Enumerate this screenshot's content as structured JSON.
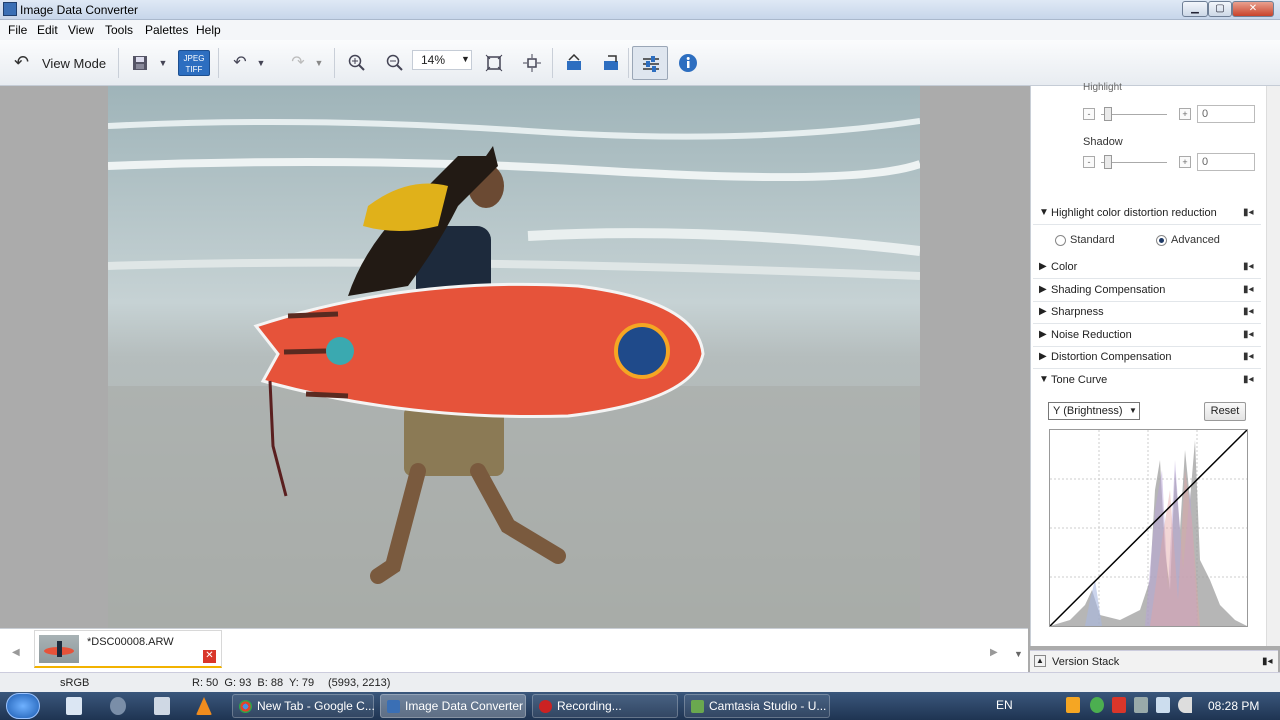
{
  "window": {
    "title": "Image Data Converter",
    "min_label": "▁",
    "max_label": "▢",
    "close_label": "✕"
  },
  "menu": [
    "File",
    "Edit",
    "View",
    "Tools",
    "Palettes",
    "Help"
  ],
  "toolbar": {
    "view_mode_label": "View Mode",
    "zoom_value": "14%",
    "jpeg_tiff_label": "JPEG TIFF"
  },
  "panel": {
    "highlight_label": "Highlight",
    "highlight_value": "0",
    "shadow_label": "Shadow",
    "shadow_value": "0",
    "sections": {
      "highlight_color": "Highlight color distortion reduction",
      "color": "Color",
      "shading": "Shading Compensation",
      "sharpness": "Sharpness",
      "noise": "Noise Reduction",
      "distortion": "Distortion Compensation",
      "tone_curve": "Tone Curve"
    },
    "radio_standard": "Standard",
    "radio_advanced": "Advanced",
    "radio_selected": "Advanced",
    "tone_channel": "Y (Brightness)",
    "reset_label": "Reset",
    "version_stack": "Version Stack"
  },
  "filmstrip": {
    "file_name": "*DSC00008.ARW",
    "close_label": "✕"
  },
  "status": {
    "color_space": "sRGB",
    "pixel_info": "R: 50  G: 93  B: 88  Y: 79",
    "coords": "(5993, 2213)"
  },
  "taskbar": {
    "tasks": [
      {
        "label": "New Tab - Google C..."
      },
      {
        "label": "Image Data Converter"
      },
      {
        "label": "Recording..."
      },
      {
        "label": "Camtasia Studio - U..."
      }
    ],
    "language": "EN",
    "clock": "08:28 PM"
  },
  "colors": {
    "accent": "#1f3a66",
    "taskbar": "#2b4466",
    "film_highlight": "#f2b200"
  }
}
